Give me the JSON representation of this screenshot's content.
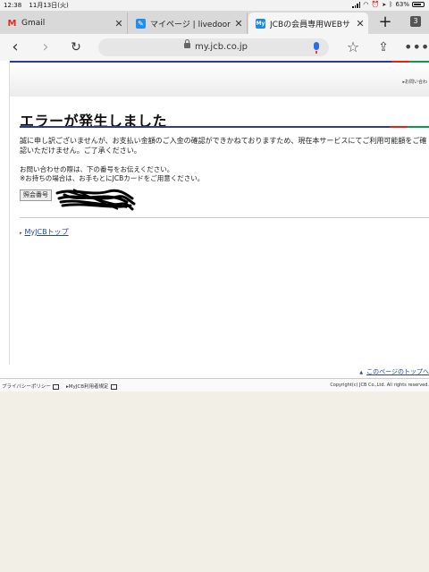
{
  "status": {
    "time": "12:38",
    "date": "11月13日(火)",
    "battery": "63%"
  },
  "tabs": [
    {
      "title": "Gmail",
      "icon": "gmail-icon",
      "active": false
    },
    {
      "title": "マイページ | livedoor Blo",
      "icon": "livedoor-blog-icon",
      "active": false
    },
    {
      "title": "JCBの会員専用WEBサ",
      "icon": "myjcb-icon",
      "active": true
    }
  ],
  "tab_count": "3",
  "address_bar": {
    "url": "my.jcb.co.jp"
  },
  "page": {
    "contact_link": "お問い合わ",
    "title": "エラーが発生しました",
    "message": "誠に申し訳ございませんが、お支払い金額のご入金の確認ができかねておりますため、現在本サービスにてご利用可能額をご確認いただけません。ご了承ください。",
    "note_line1": "お問い合わせの際は、下の番号をお伝えください。",
    "note_line2": "※お持ちの場合は、お手もとにJCBカードをご用意ください。",
    "reference_label": "照会番号",
    "myjcb_top_link": "MyJCBトップ",
    "page_top_link": "このページのトップへ"
  },
  "footer": {
    "privacy": "プライバシーポリシー",
    "terms": "MyJCB利用者規定",
    "copyright": "Copyright(c) JCB Co.,Ltd. All rights reserved."
  },
  "colors": {
    "jcb_blue": "#2b3d8f",
    "jcb_red": "#e2231a",
    "jcb_green": "#0a9b48",
    "link": "#2546a6"
  }
}
